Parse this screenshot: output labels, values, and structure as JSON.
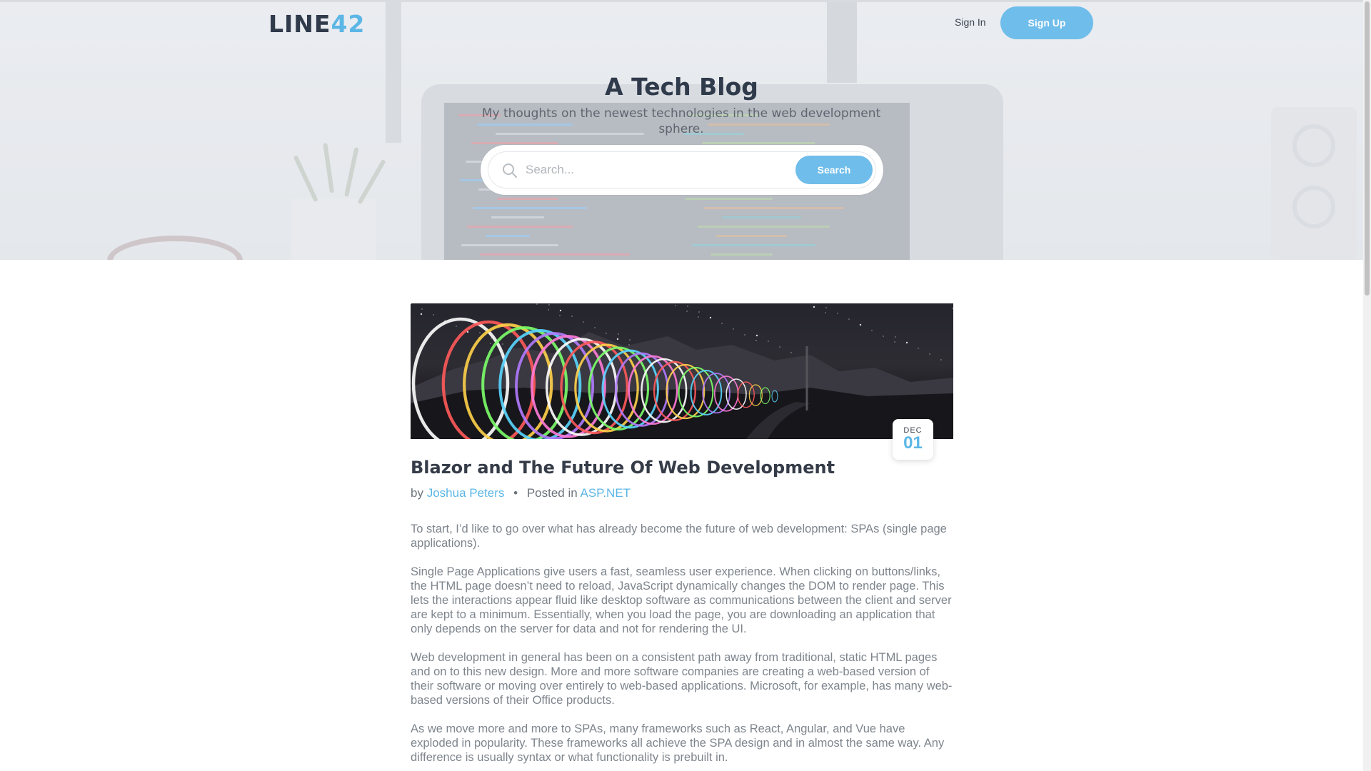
{
  "header": {
    "logo_text": "LINE",
    "logo_accent": "42",
    "sign_in_label": "Sign In",
    "sign_up_label": "Sign Up"
  },
  "hero": {
    "title": "A Tech Blog",
    "subtitle": "My thoughts on the newest technologies in the web development sphere.",
    "search": {
      "placeholder": "Search...",
      "value": "",
      "button_label": "Search"
    }
  },
  "post": {
    "date_month": "DEC",
    "date_day": "01",
    "title": "Blazor and The Future Of Web Development",
    "by_label": "by",
    "author": "Joshua Peters",
    "meta_separator": "•",
    "posted_in_label": "Posted in",
    "category": "ASP.NET",
    "paragraphs": [
      "To start, I’d like to go over what has already become the future of web development: SPAs (single page applications).",
      "Single Page Applications give users a fast, seamless user experience. When clicking on buttons/links, the HTML page doesn’t need to reload, JavaScript dynamically changes the DOM to render page. This lets the interactions appear fluid like desktop software as communications between the client and server are kept to a minimum. Essentially, when you load the page, you are downloading an application that only depends on the server for data and not for rendering the UI.",
      "Web development in general has been on a consistent path away from traditional, static HTML pages and on to this new design. More and more software companies are creating a web-based version of their software or moving over entirely to web-based applications. Microsoft, for example, has many web-based versions of their Office products.",
      "As we move more and more to SPAs, many frameworks such as React, Angular, and Vue have exploded in popularity. These frameworks all achieve the SPA design and in almost the same way. Any difference is usually syntax or what functionality is prebuilt in."
    ]
  },
  "colors": {
    "accent": "#5cb6e6",
    "button": "#6fbdea",
    "heading": "#2f3a4b",
    "body_text": "#7e858d"
  },
  "icons": {
    "search": "search-icon"
  }
}
